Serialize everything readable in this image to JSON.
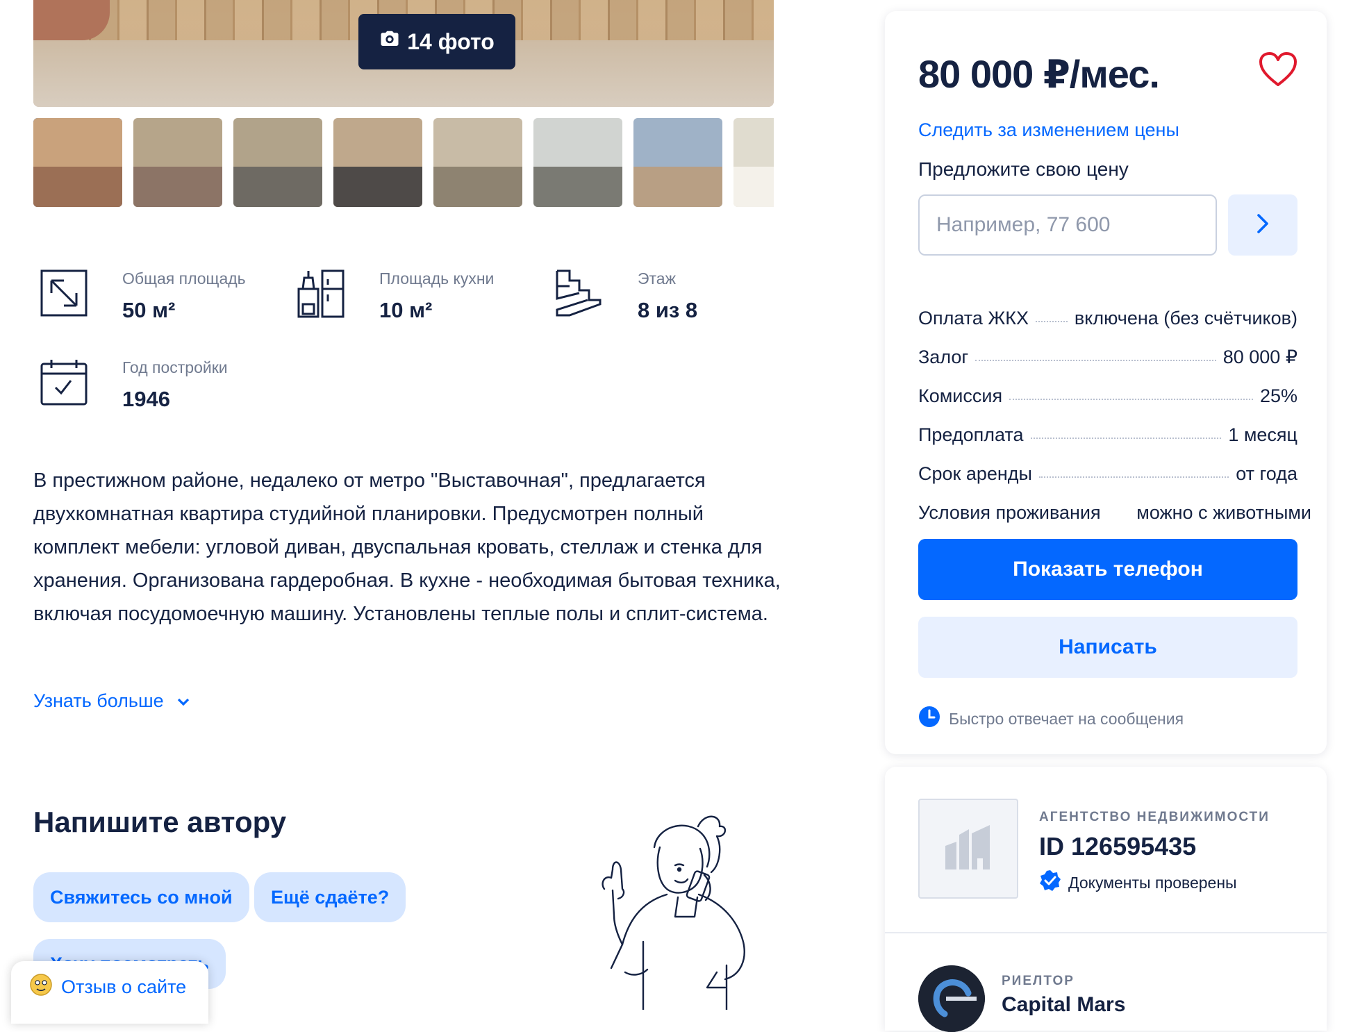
{
  "gallery": {
    "photo_count_label": "14 фото",
    "thumbnails": [
      {
        "colors": [
          "#c9a27c",
          "#9b6f55"
        ],
        "active": true
      },
      {
        "colors": [
          "#b6a58a",
          "#8c7466"
        ],
        "active": false
      },
      {
        "colors": [
          "#b1a38a",
          "#6e6a63"
        ],
        "active": false
      },
      {
        "colors": [
          "#bfa88c",
          "#4e4a48"
        ],
        "active": false
      },
      {
        "colors": [
          "#c8bba6",
          "#8e8371"
        ],
        "active": false
      },
      {
        "colors": [
          "#d1d4d1",
          "#7a7a73"
        ],
        "active": false
      },
      {
        "colors": [
          "#9fb2c7",
          "#b89f84"
        ],
        "active": false
      },
      {
        "colors": [
          "#e0dccf",
          "#f4f1ea"
        ],
        "active": false
      }
    ]
  },
  "features": [
    {
      "icon": "area-icon",
      "label": "Общая площадь",
      "value": "50 м²"
    },
    {
      "icon": "kitchen-icon",
      "label": "Площадь кухни",
      "value": "10 м²"
    },
    {
      "icon": "stairs-icon",
      "label": "Этаж",
      "value": "8 из 8"
    },
    {
      "icon": "calendar-icon",
      "label": "Год постройки",
      "value": "1946"
    }
  ],
  "description": "В престижном районе, недалеко от метро \"Выставочная\", предлагается двухкомнатная квартира студийной планировки. Предусмотрен полный комплект мебели: угловой диван, двуспальная кровать, стеллаж и стенка для хранения. Организована гардеробная. В кухне - необходимая бытовая техника, включая посудомоечную машину. Установлены теплые полы и сплит-система.",
  "more_link": "Узнать больше",
  "write_author": {
    "title": "Напишите автору",
    "chips": [
      "Свяжитесь со мной",
      "Ещё сдаёте?",
      "Хочу посмотреть"
    ]
  },
  "feedback_label": "Отзыв о сайте",
  "price_card": {
    "price": "80 000 ₽/мес.",
    "watch_price": "Следить за изменением цены",
    "offer_label": "Предложите свою цену",
    "offer_placeholder": "Например, 77 600",
    "terms": [
      {
        "label": "Оплата ЖКХ",
        "value": "включена (без счётчиков)"
      },
      {
        "label": "Залог",
        "value": "80 000 ₽"
      },
      {
        "label": "Комиссия",
        "value": "25%"
      },
      {
        "label": "Предоплата",
        "value": "1 месяц"
      },
      {
        "label": "Срок аренды",
        "value": "от года"
      },
      {
        "label": "Условия проживания",
        "value": "можно с животными"
      }
    ],
    "show_phone": "Показать телефон",
    "write": "Написать",
    "fast_reply": "Быстро отвечает на сообщения"
  },
  "agent": {
    "type": "АГЕНТСТВО НЕДВИЖИМОСТИ",
    "id": "ID 126595435",
    "verified": "Документы проверены",
    "realtor_role": "РИЕЛТОР",
    "realtor_name": "Capital Mars"
  },
  "colors": {
    "accent": "#0468ff",
    "text": "#152242",
    "muted": "#707a8f",
    "heart": "#e0192d"
  }
}
